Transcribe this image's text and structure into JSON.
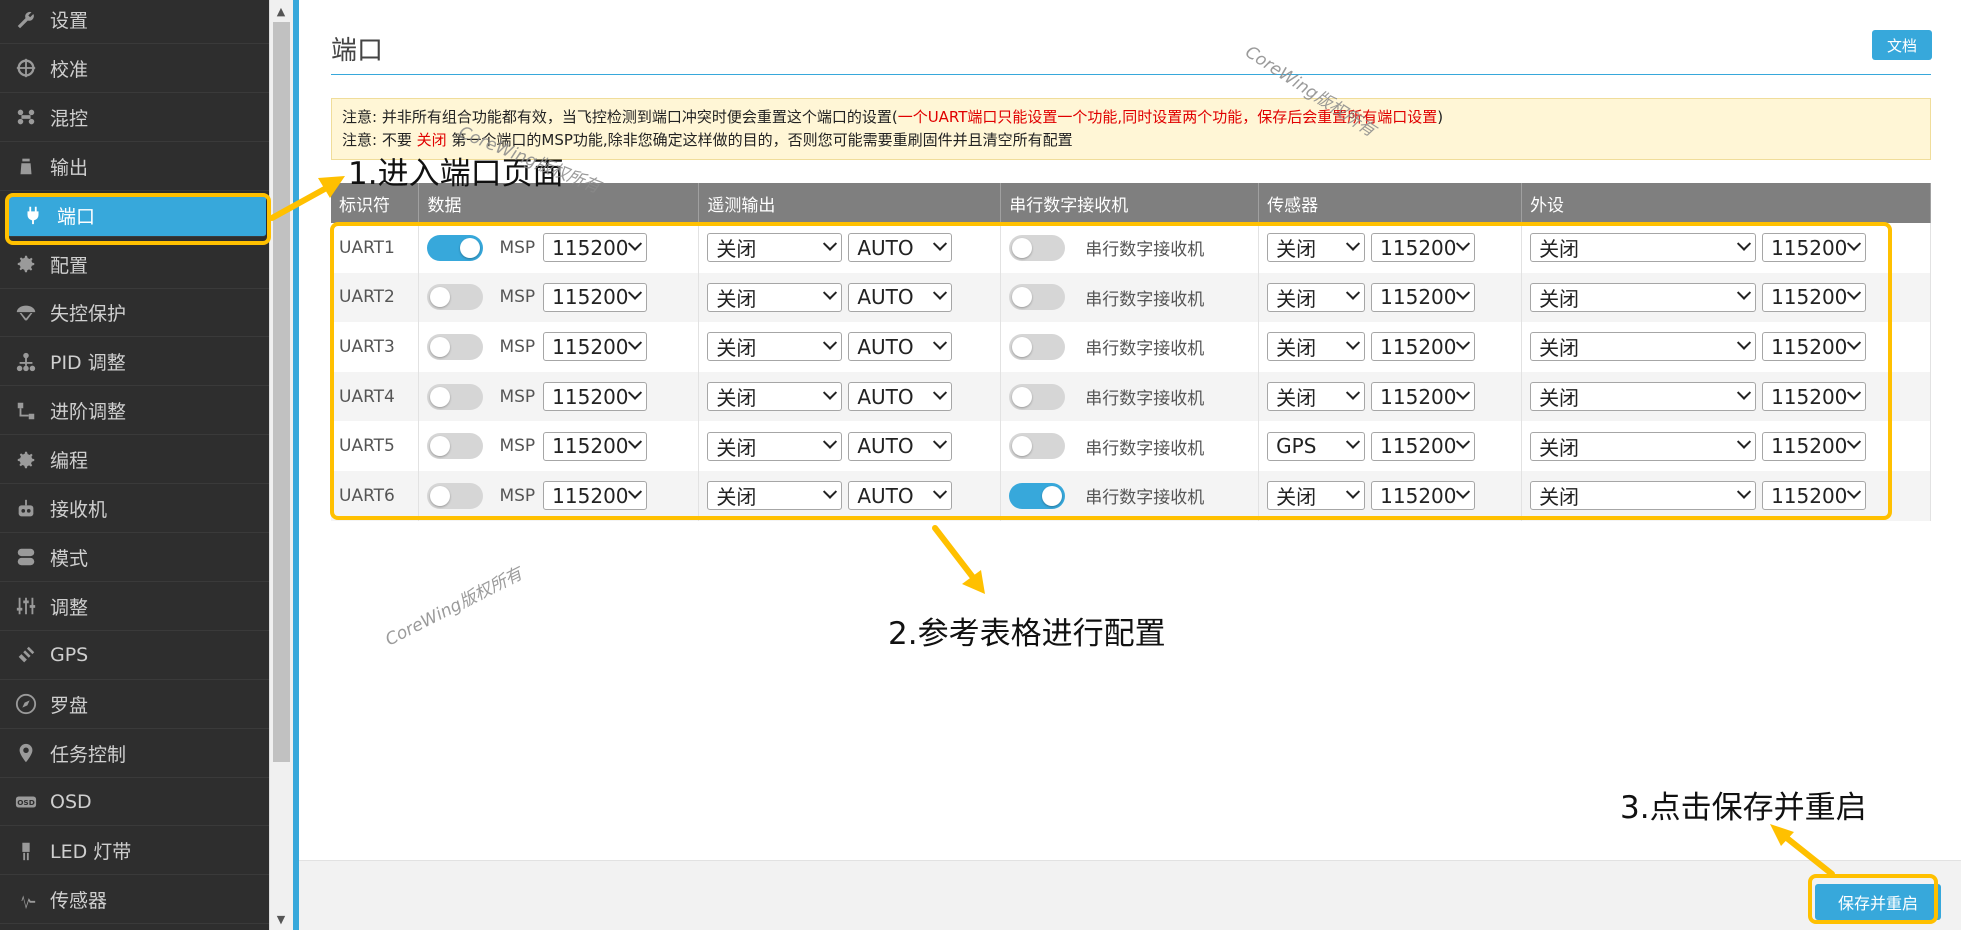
{
  "sidebar": {
    "items": [
      {
        "label": "设置",
        "icon": "wrench-icon"
      },
      {
        "label": "校准",
        "icon": "crosshair-icon"
      },
      {
        "label": "混控",
        "icon": "mixer-icon"
      },
      {
        "label": "输出",
        "icon": "motor-icon"
      },
      {
        "label": "端口",
        "icon": "plug-icon",
        "active": true
      },
      {
        "label": "配置",
        "icon": "gear-icon"
      },
      {
        "label": "失控保护",
        "icon": "parachute-icon"
      },
      {
        "label": "PID 调整",
        "icon": "pid-icon"
      },
      {
        "label": "进阶调整",
        "icon": "advanced-tuning-icon"
      },
      {
        "label": "编程",
        "icon": "gear-icon"
      },
      {
        "label": "接收机",
        "icon": "receiver-icon"
      },
      {
        "label": "模式",
        "icon": "toggle-icon"
      },
      {
        "label": "调整",
        "icon": "sliders-icon"
      },
      {
        "label": "GPS",
        "icon": "satellite-icon"
      },
      {
        "label": "罗盘",
        "icon": "compass-icon"
      },
      {
        "label": "任务控制",
        "icon": "map-pin-icon"
      },
      {
        "label": "OSD",
        "icon": "osd-icon"
      },
      {
        "label": "LED 灯带",
        "icon": "led-icon"
      },
      {
        "label": "传感器",
        "icon": "pulse-icon"
      }
    ]
  },
  "main": {
    "title": "端口",
    "docs_label": "文档",
    "notice": {
      "line1_prefix": "注意: 并非所有组合功能都有效，当飞控检测到端口冲突时便会重置这个端口的设置(",
      "line1_red": "一个UART端口只能设置一个功能,同时设置两个功能，保存后会重置所有端口设置",
      "line1_suffix": ")",
      "line2_prefix": "注意: 不要 ",
      "line2_red": "关闭",
      "line2_suffix": " 第一个端口的MSP功能,除非您确定这样做的目的，否则您可能需要重刷固件并且清空所有配置"
    },
    "table": {
      "headers": [
        "标识符",
        "数据",
        "遥测输出",
        "串行数字接收机",
        "传感器",
        "外设"
      ],
      "msp_label": "MSP",
      "rx_label": "串行数字接收机",
      "rows": [
        {
          "id": "UART1",
          "msp_on": true,
          "msp_baud": "115200",
          "telemetry": "关闭",
          "telemetry_baud": "AUTO",
          "serial_rx_on": false,
          "sensor": "关闭",
          "sensor_baud": "115200",
          "peripheral": "关闭",
          "peripheral_baud": "115200"
        },
        {
          "id": "UART2",
          "msp_on": false,
          "msp_baud": "115200",
          "telemetry": "关闭",
          "telemetry_baud": "AUTO",
          "serial_rx_on": false,
          "sensor": "关闭",
          "sensor_baud": "115200",
          "peripheral": "关闭",
          "peripheral_baud": "115200"
        },
        {
          "id": "UART3",
          "msp_on": false,
          "msp_baud": "115200",
          "telemetry": "关闭",
          "telemetry_baud": "AUTO",
          "serial_rx_on": false,
          "sensor": "关闭",
          "sensor_baud": "115200",
          "peripheral": "关闭",
          "peripheral_baud": "115200"
        },
        {
          "id": "UART4",
          "msp_on": false,
          "msp_baud": "115200",
          "telemetry": "关闭",
          "telemetry_baud": "AUTO",
          "serial_rx_on": false,
          "sensor": "关闭",
          "sensor_baud": "115200",
          "peripheral": "关闭",
          "peripheral_baud": "115200"
        },
        {
          "id": "UART5",
          "msp_on": false,
          "msp_baud": "115200",
          "telemetry": "关闭",
          "telemetry_baud": "AUTO",
          "serial_rx_on": false,
          "sensor": "GPS",
          "sensor_baud": "115200",
          "peripheral": "关闭",
          "peripheral_baud": "115200"
        },
        {
          "id": "UART6",
          "msp_on": false,
          "msp_baud": "115200",
          "telemetry": "关闭",
          "telemetry_baud": "AUTO",
          "serial_rx_on": true,
          "sensor": "关闭",
          "sensor_baud": "115200",
          "peripheral": "关闭",
          "peripheral_baud": "115200"
        }
      ]
    },
    "save_label": "保存并重启"
  },
  "annotations": {
    "step1": "1.进入端口页面",
    "step2": "2.参考表格进行配置",
    "step3": "3.点击保存并重启",
    "watermark": "CoreWing版权所有",
    "highlight_color": "#ffc000"
  },
  "colors": {
    "accent": "#37a8db",
    "sidebar_bg": "#2e2e2e",
    "header_bg": "#7f7f7f",
    "notice_bg": "#fff6d6",
    "warning_red": "#e00000"
  }
}
